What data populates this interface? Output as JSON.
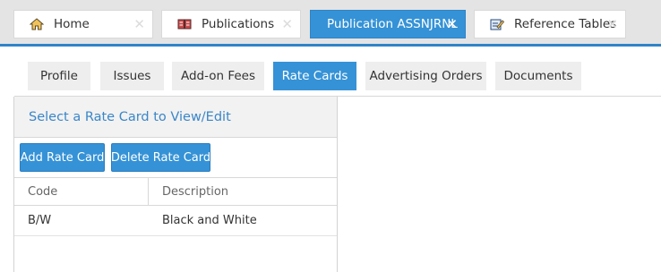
{
  "top_tabs": [
    {
      "label": "Home",
      "icon": "home-icon"
    },
    {
      "label": "Publications",
      "icon": "book-icon"
    },
    {
      "label": "Publication ASSNJRNL",
      "active": true
    },
    {
      "label": "Reference Tables",
      "icon": "edit-icon"
    }
  ],
  "sub_tabs": [
    "Profile",
    "Issues",
    "Add-on Fees",
    "Rate Cards",
    "Advertising Orders",
    "Documents"
  ],
  "active_sub_tab": "Rate Cards",
  "panel": {
    "title": "Select a Rate Card to View/Edit",
    "add_label": "Add Rate Card",
    "delete_label": "Delete Rate Card",
    "columns": [
      "Code",
      "Description"
    ],
    "rows": [
      {
        "code": "B/W",
        "description": "Black and White"
      }
    ]
  },
  "colors": {
    "accent": "#3592d6",
    "panel_title": "#3a86c8"
  }
}
